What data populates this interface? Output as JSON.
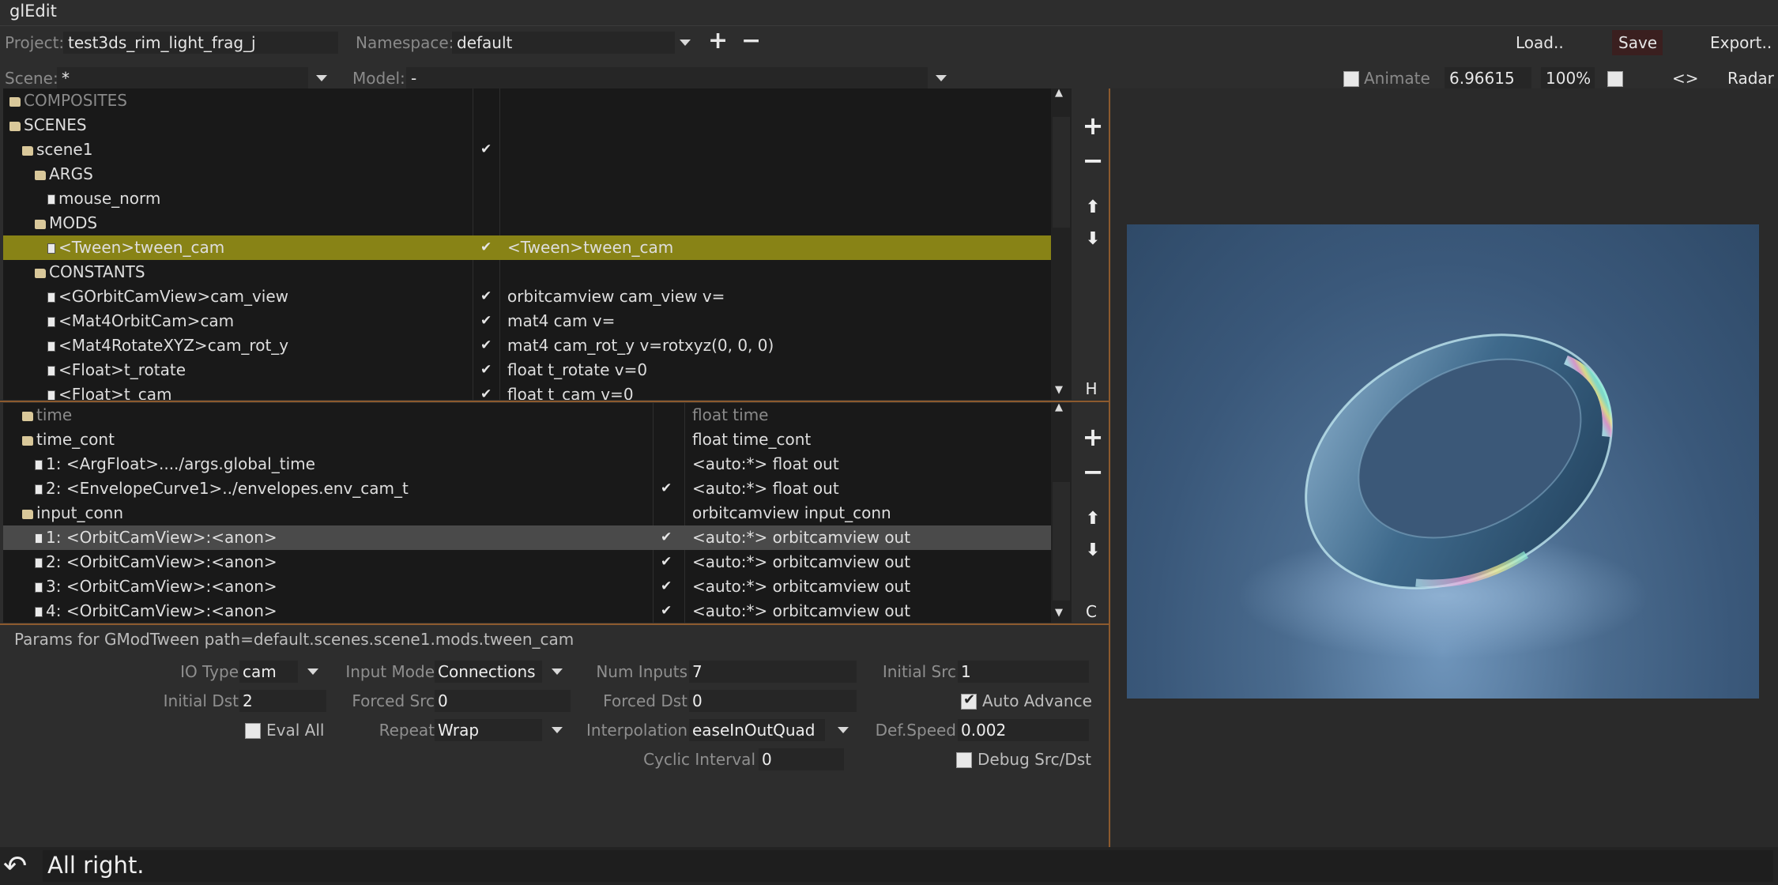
{
  "app": {
    "title": "glEdit"
  },
  "toolbar": {
    "project_label": "Project:",
    "project_value": "test3ds_rim_light_frag_j",
    "namespace_label": "Namespace:",
    "namespace_value": "default",
    "add_label": "+",
    "remove_label": "−",
    "load_label": "Load..",
    "save_label": "Save",
    "export_label": "Export..",
    "scene_label": "Scene:",
    "scene_value": "*",
    "model_label": "Model:",
    "model_value": "-",
    "animate_label": "Animate",
    "time_value": "6.96615",
    "zoom_value": "100%",
    "swap_label": "<>",
    "mode_label": "Radar"
  },
  "tree": {
    "rows": [
      {
        "label": "COMPOSITES",
        "icon": "folder",
        "indent": 0,
        "checked": false,
        "value": "",
        "dim": true
      },
      {
        "label": "SCENES",
        "icon": "folder",
        "indent": 0,
        "checked": false,
        "value": "",
        "dim": false
      },
      {
        "label": "scene1",
        "icon": "folder",
        "indent": 1,
        "checked": true,
        "value": "",
        "dim": false
      },
      {
        "label": "ARGS",
        "icon": "folder",
        "indent": 2,
        "checked": false,
        "value": "",
        "dim": false
      },
      {
        "label": "mouse_norm",
        "icon": "doc",
        "indent": 3,
        "checked": false,
        "value": "",
        "dim": false
      },
      {
        "label": "MODS",
        "icon": "folder",
        "indent": 2,
        "checked": false,
        "value": "",
        "dim": false
      },
      {
        "label": "<Tween>tween_cam",
        "icon": "doc",
        "indent": 3,
        "checked": true,
        "value": "<Tween>tween_cam",
        "dim": false,
        "selected": true
      },
      {
        "label": "CONSTANTS",
        "icon": "folder",
        "indent": 2,
        "checked": false,
        "value": "",
        "dim": false
      },
      {
        "label": "<GOrbitCamView>cam_view",
        "icon": "doc",
        "indent": 3,
        "checked": true,
        "value": "orbitcamview cam_view v=",
        "dim": false
      },
      {
        "label": "<Mat4OrbitCam>cam",
        "icon": "doc",
        "indent": 3,
        "checked": true,
        "value": "mat4 cam v=",
        "dim": false
      },
      {
        "label": "<Mat4RotateXYZ>cam_rot_y",
        "icon": "doc",
        "indent": 3,
        "checked": true,
        "value": "mat4 cam_rot_y v=rotxyz(0, 0, 0)",
        "dim": false
      },
      {
        "label": "<Float>t_rotate",
        "icon": "doc",
        "indent": 3,
        "checked": true,
        "value": "float t_rotate v=0",
        "dim": false
      },
      {
        "label": "<Float>t_cam",
        "icon": "doc",
        "indent": 3,
        "checked": true,
        "value": "float t_cam v=0",
        "dim": false
      }
    ],
    "side_buttons": {
      "add": "+",
      "remove": "−",
      "up": "⬆",
      "down": "⬇",
      "tag": "H"
    }
  },
  "connections": {
    "rows": [
      {
        "label": "time",
        "icon": "folder",
        "indent": 1,
        "checked": false,
        "value": "float time",
        "dim": true
      },
      {
        "label": "time_cont",
        "icon": "folder",
        "indent": 1,
        "checked": false,
        "value": "float time_cont",
        "dim": false
      },
      {
        "label": "1: <ArgFloat>..../args.global_time",
        "icon": "doc",
        "indent": 2,
        "checked": false,
        "value": "<auto:*> float out",
        "dim": false
      },
      {
        "label": "2: <EnvelopeCurve1>../envelopes.env_cam_t",
        "icon": "doc",
        "indent": 2,
        "checked": true,
        "value": "<auto:*> float out",
        "dim": false
      },
      {
        "label": "input_conn",
        "icon": "folder",
        "indent": 1,
        "checked": false,
        "value": "orbitcamview input_conn",
        "dim": false
      },
      {
        "label": "1: <OrbitCamView>:<anon>",
        "icon": "doc",
        "indent": 2,
        "checked": true,
        "value": "<auto:*> orbitcamview out",
        "dim": false,
        "selected": true
      },
      {
        "label": "2: <OrbitCamView>:<anon>",
        "icon": "doc",
        "indent": 2,
        "checked": true,
        "value": "<auto:*> orbitcamview out",
        "dim": false
      },
      {
        "label": "3: <OrbitCamView>:<anon>",
        "icon": "doc",
        "indent": 2,
        "checked": true,
        "value": "<auto:*> orbitcamview out",
        "dim": false
      },
      {
        "label": "4: <OrbitCamView>:<anon>",
        "icon": "doc",
        "indent": 2,
        "checked": true,
        "value": "<auto:*> orbitcamview out",
        "dim": false
      }
    ],
    "side_buttons": {
      "add": "+",
      "remove": "−",
      "up": "⬆",
      "down": "⬇",
      "tag": "C"
    }
  },
  "params": {
    "title": "Params for GModTween path=default.scenes.scene1.mods.tween_cam",
    "io_type_label": "IO Type",
    "io_type_value": "cam",
    "input_mode_label": "Input Mode",
    "input_mode_value": "Connections",
    "num_inputs_label": "Num Inputs",
    "num_inputs_value": "7",
    "initial_src_label": "Initial Src",
    "initial_src_value": "1",
    "initial_dst_label": "Initial Dst",
    "initial_dst_value": "2",
    "forced_src_label": "Forced Src",
    "forced_src_value": "0",
    "forced_dst_label": "Forced Dst",
    "forced_dst_value": "0",
    "auto_advance_label": "Auto Advance",
    "eval_all_label": "Eval All",
    "repeat_label": "Repeat",
    "repeat_value": "Wrap",
    "interpolation_label": "Interpolation",
    "interpolation_value": "easeInOutQuad",
    "def_speed_label": "Def.Speed",
    "def_speed_value": "0.002",
    "cyclic_interval_label": "Cyclic Interval",
    "cyclic_interval_value": "0",
    "debug_label": "Debug Src/Dst"
  },
  "status": {
    "message": "All right."
  },
  "colors": {
    "selection": "#888316",
    "accent_line": "#8c5a2e",
    "viewport_bg": "#3d5a78"
  }
}
